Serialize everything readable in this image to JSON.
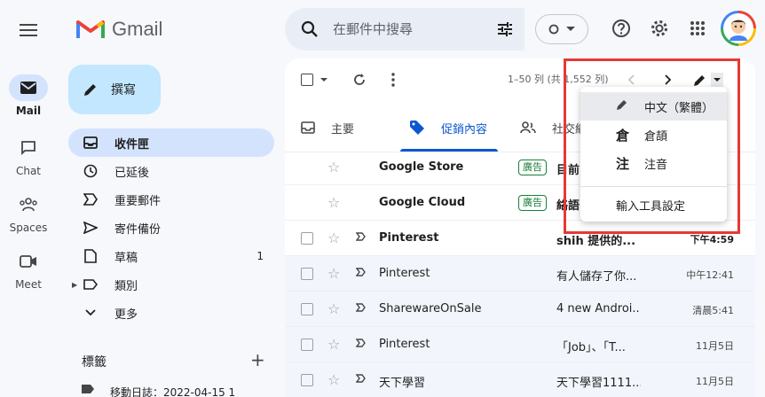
{
  "app": {
    "name": "Gmail"
  },
  "rail": [
    {
      "label": "Mail",
      "icon": "mail-icon",
      "active": true
    },
    {
      "label": "Chat",
      "icon": "chat-icon"
    },
    {
      "label": "Spaces",
      "icon": "spaces-icon"
    },
    {
      "label": "Meet",
      "icon": "meet-icon"
    }
  ],
  "search": {
    "placeholder": "在郵件中搜尋"
  },
  "compose": {
    "label": "撰寫"
  },
  "nav": [
    {
      "label": "收件匣",
      "icon": "inbox-icon",
      "active": true
    },
    {
      "label": "已延後",
      "icon": "clock-icon"
    },
    {
      "label": "重要郵件",
      "icon": "important-icon"
    },
    {
      "label": "寄件備份",
      "icon": "send-icon"
    },
    {
      "label": "草稿",
      "icon": "draft-icon",
      "count": "1"
    },
    {
      "label": "類別",
      "icon": "label-icon"
    },
    {
      "label": "更多",
      "icon": "chevron-down-icon"
    }
  ],
  "labels": {
    "title": "標籤",
    "first_item": "移動日誌：2022-04-15 1"
  },
  "toolbar": {
    "pager": "1–50 列 (共 1,552 列)"
  },
  "tabs": [
    {
      "label": "主要",
      "icon": "inbox-tab-icon"
    },
    {
      "label": "促銷內容",
      "icon": "tag-icon",
      "active": true
    },
    {
      "label": "社交網",
      "icon": "people-icon"
    }
  ],
  "emails": [
    {
      "sender": "Google Store",
      "badge": "廣告",
      "subject": "目前",
      "time": "",
      "unread": true,
      "ad": true
    },
    {
      "sender": "Google Cloud",
      "badge": "廣告",
      "subject": "絡語",
      "time": "",
      "unread": true,
      "ad": true
    },
    {
      "sender": "Pinterest",
      "subject": "shih 提供的...",
      "time": "下午4:59",
      "unread": true
    },
    {
      "sender": "Pinterest",
      "subject": "有人儲存了你...",
      "time": "中午12:41",
      "unread": false
    },
    {
      "sender": "SharewareOnSale",
      "subject": "4 new Androi...",
      "time": "清晨5:41",
      "unread": false
    },
    {
      "sender": "Pinterest",
      "subject": "「Job」、「T...",
      "time": "11月5日",
      "unread": false
    },
    {
      "sender": "天下學習",
      "subject": "天下學習1111...",
      "time": "11月5日",
      "unread": false
    }
  ],
  "ime_menu": {
    "items": [
      {
        "label": "中文（繁體）",
        "icon": "pencil-icon",
        "selected": true
      },
      {
        "label": "倉頡",
        "icon_text": "倉"
      },
      {
        "label": "注音",
        "icon_text": "注"
      }
    ],
    "settings": "輸入工具設定"
  },
  "colors": {
    "accent": "#0b57d0",
    "highlight": "#e53935",
    "ad_badge": "#188038"
  }
}
